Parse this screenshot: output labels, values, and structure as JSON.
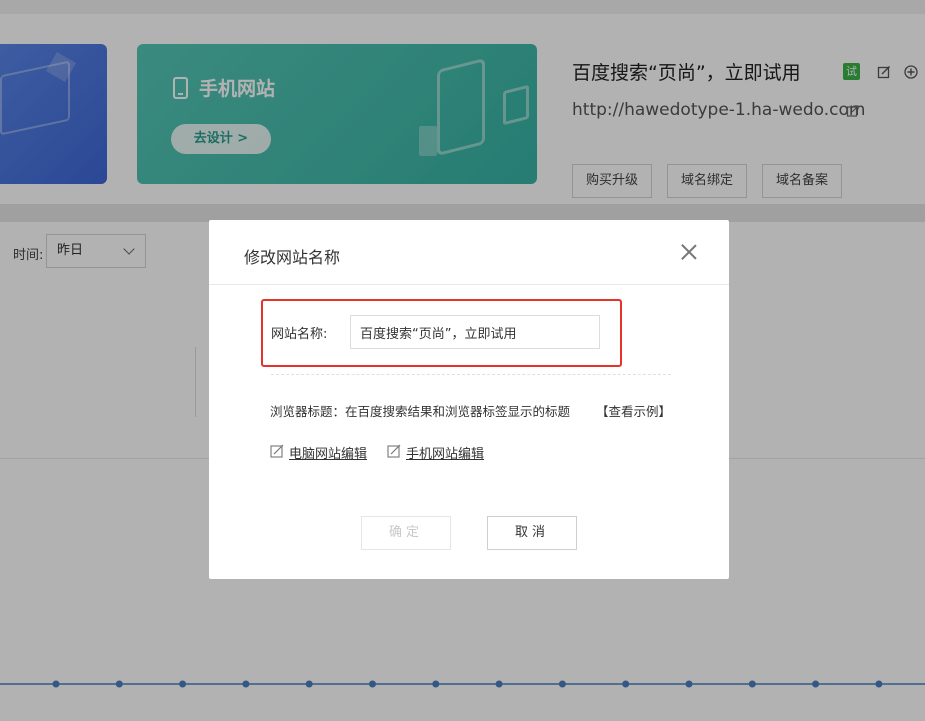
{
  "header": {
    "mobile_card_title": "手机网站",
    "design_button": "去设计 >",
    "site_title": "百度搜索“页尚”，立即试用",
    "trial_badge": "试",
    "site_url": "http://hawedotype-1.ha-wedo.com",
    "actions": [
      "购买升级",
      "域名绑定",
      "域名备案"
    ],
    "icons": [
      "phone-icon",
      "edit-icon",
      "add-icon",
      "external-link-icon"
    ]
  },
  "filters": {
    "time_label": "时间:",
    "time_value": "昨日"
  },
  "dialog": {
    "title": "修改网站名称",
    "name_label": "网站名称:",
    "name_value": "百度搜索“页尚”，立即试用",
    "browser_title_label": "浏览器标题：在百度搜索结果和浏览器标签显示的标题",
    "view_example": "【查看示例】",
    "pc_edit_link": "电脑网站编辑",
    "mobile_edit_link": "手机网站编辑",
    "confirm": "确定",
    "cancel": "取消"
  },
  "colors": {
    "highlight": "#e6322b",
    "trial_badge": "#3bb34a",
    "mobile_card": "#45bdae",
    "pc_card": "#4b76df",
    "chart_line": "#4a7fbf"
  }
}
